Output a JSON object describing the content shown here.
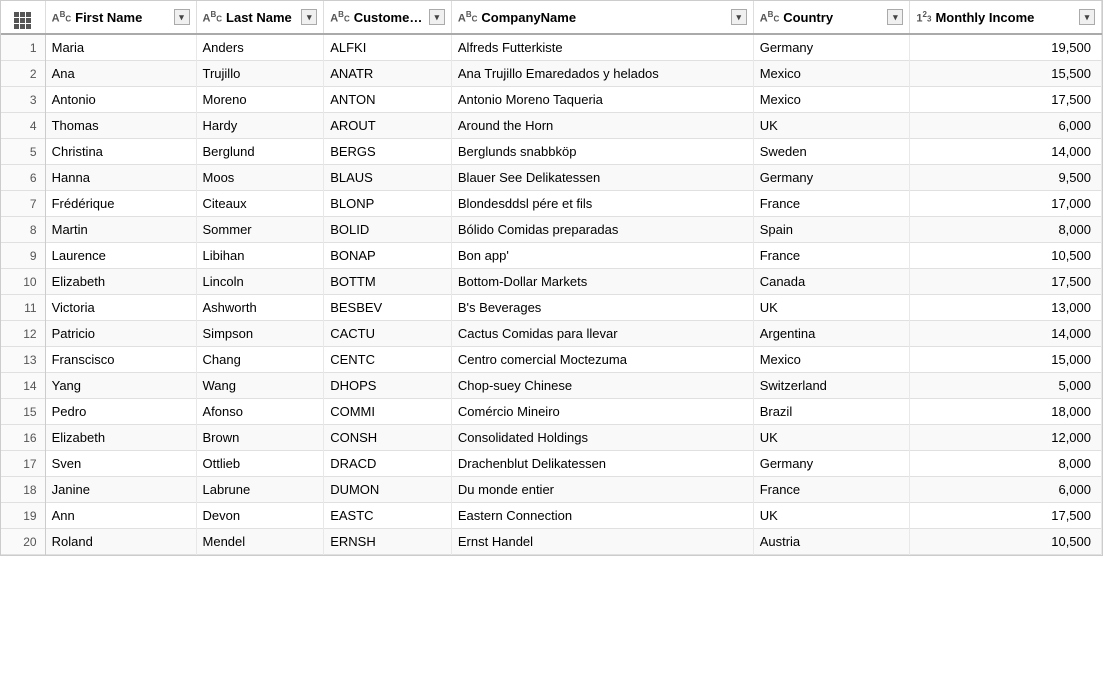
{
  "columns": [
    {
      "id": "row",
      "label": "",
      "type": ""
    },
    {
      "id": "firstname",
      "label": "First Name",
      "type": "ABC"
    },
    {
      "id": "lastname",
      "label": "Last Name",
      "type": "ABC"
    },
    {
      "id": "customerid",
      "label": "CustomerID",
      "type": "ABC"
    },
    {
      "id": "companyname",
      "label": "CompanyName",
      "type": "ABC"
    },
    {
      "id": "country",
      "label": "Country",
      "type": "ABC"
    },
    {
      "id": "income",
      "label": "Monthly Income",
      "type": "123"
    }
  ],
  "rows": [
    {
      "row": 1,
      "firstname": "Maria",
      "lastname": "Anders",
      "customerid": "ALFKI",
      "companyname": "Alfreds Futterkiste",
      "country": "Germany",
      "income": 19500
    },
    {
      "row": 2,
      "firstname": "Ana",
      "lastname": "Trujillo",
      "customerid": "ANATR",
      "companyname": "Ana Trujillo Emaredados y helados",
      "country": "Mexico",
      "income": 15500
    },
    {
      "row": 3,
      "firstname": "Antonio",
      "lastname": "Moreno",
      "customerid": "ANTON",
      "companyname": "Antonio Moreno Taqueria",
      "country": "Mexico",
      "income": 17500
    },
    {
      "row": 4,
      "firstname": "Thomas",
      "lastname": "Hardy",
      "customerid": "AROUT",
      "companyname": "Around the Horn",
      "country": "UK",
      "income": 6000
    },
    {
      "row": 5,
      "firstname": "Christina",
      "lastname": "Berglund",
      "customerid": "BERGS",
      "companyname": "Berglunds snabbköp",
      "country": "Sweden",
      "income": 14000
    },
    {
      "row": 6,
      "firstname": "Hanna",
      "lastname": "Moos",
      "customerid": "BLAUS",
      "companyname": "Blauer See Delikatessen",
      "country": "Germany",
      "income": 9500
    },
    {
      "row": 7,
      "firstname": "Frédérique",
      "lastname": "Citeaux",
      "customerid": "BLONP",
      "companyname": "Blondesddsl pére et fils",
      "country": "France",
      "income": 17000
    },
    {
      "row": 8,
      "firstname": "Martin",
      "lastname": "Sommer",
      "customerid": "BOLID",
      "companyname": "Bólido Comidas preparadas",
      "country": "Spain",
      "income": 8000
    },
    {
      "row": 9,
      "firstname": "Laurence",
      "lastname": "Libihan",
      "customerid": "BONAP",
      "companyname": "Bon app'",
      "country": "France",
      "income": 10500
    },
    {
      "row": 10,
      "firstname": "Elizabeth",
      "lastname": "Lincoln",
      "customerid": "BOTTM",
      "companyname": "Bottom-Dollar Markets",
      "country": "Canada",
      "income": 17500
    },
    {
      "row": 11,
      "firstname": "Victoria",
      "lastname": "Ashworth",
      "customerid": "BESBEV",
      "companyname": "B's Beverages",
      "country": "UK",
      "income": 13000
    },
    {
      "row": 12,
      "firstname": "Patricio",
      "lastname": "Simpson",
      "customerid": "CACTU",
      "companyname": "Cactus Comidas para llevar",
      "country": "Argentina",
      "income": 14000
    },
    {
      "row": 13,
      "firstname": "Franscisco",
      "lastname": "Chang",
      "customerid": "CENTC",
      "companyname": "Centro comercial Moctezuma",
      "country": "Mexico",
      "income": 15000
    },
    {
      "row": 14,
      "firstname": "Yang",
      "lastname": "Wang",
      "customerid": "DHOPS",
      "companyname": "Chop-suey Chinese",
      "country": "Switzerland",
      "income": 5000
    },
    {
      "row": 15,
      "firstname": "Pedro",
      "lastname": "Afonso",
      "customerid": "COMMI",
      "companyname": "Comércio Mineiro",
      "country": "Brazil",
      "income": 18000
    },
    {
      "row": 16,
      "firstname": "Elizabeth",
      "lastname": "Brown",
      "customerid": "CONSH",
      "companyname": "Consolidated Holdings",
      "country": "UK",
      "income": 12000
    },
    {
      "row": 17,
      "firstname": "Sven",
      "lastname": "Ottlieb",
      "customerid": "DRACD",
      "companyname": "Drachenblut Delikatessen",
      "country": "Germany",
      "income": 8000
    },
    {
      "row": 18,
      "firstname": "Janine",
      "lastname": "Labrune",
      "customerid": "DUMON",
      "companyname": "Du monde entier",
      "country": "France",
      "income": 6000
    },
    {
      "row": 19,
      "firstname": "Ann",
      "lastname": "Devon",
      "customerid": "EASTC",
      "companyname": "Eastern Connection",
      "country": "UK",
      "income": 17500
    },
    {
      "row": 20,
      "firstname": "Roland",
      "lastname": "Mendel",
      "customerid": "ERNSH",
      "companyname": "Ernst Handel",
      "country": "Austria",
      "income": 10500
    }
  ]
}
